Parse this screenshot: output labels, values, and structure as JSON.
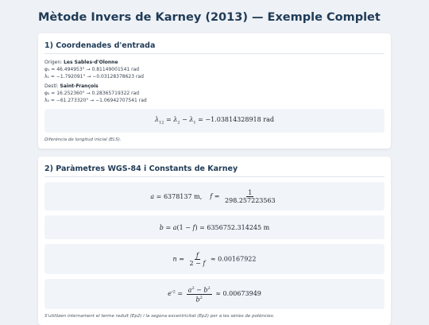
{
  "title": "Mètode Invers de Karney (2013) — Exemple Complet",
  "section1": {
    "heading": "1) Coordenades d'entrada",
    "origin_label": "Origen: ",
    "origin_name": "Les Sables-d'Olonne",
    "origin_phi": "φ₁ = 46.494953° → 0.81149001541 rad",
    "origin_lambda": "λ₁ = −1.792091° → −0.03128378623 rad",
    "dest_label": "Destí: ",
    "dest_name": "Saint-François",
    "dest_phi": "φ₂ = 16.252360° → 0.28365719322 rad",
    "dest_lambda": "λ₂ = −61.273320° → −1.06942707541 rad",
    "eq_value": "−1.03814328918",
    "eq_unit": "rad",
    "note": "Diferència de longitud inicial (ELS)."
  },
  "section2": {
    "heading": "2) Paràmetres WGS-84 i Constants de Karney",
    "a_value": "6378137 m,",
    "f_num": "1",
    "f_den": "298.257223563",
    "b_value": "6356752.314245 m",
    "n_value": "≈ 0.00167922",
    "e2_value": "≈ 0.00673949",
    "footnote": "S'utilitzen internament el terme reduït (Ep2) i la segona excentricitat (Ep2) per a les sèries de potències."
  }
}
